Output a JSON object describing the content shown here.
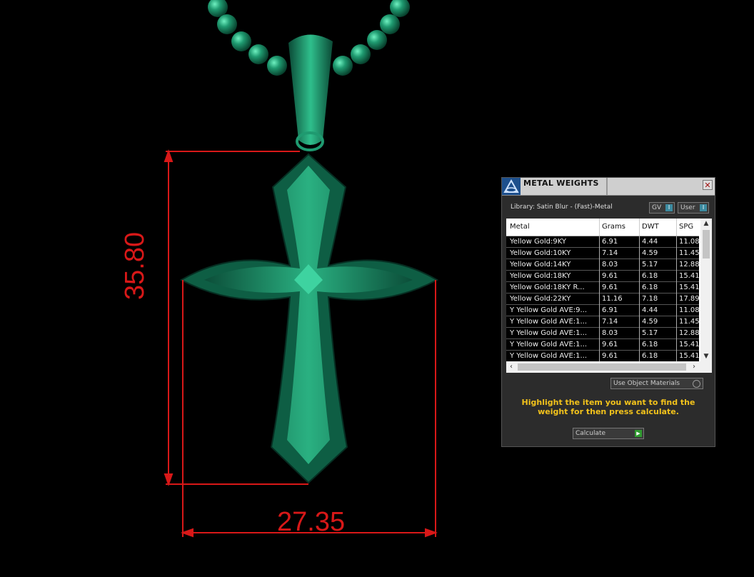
{
  "scene": {
    "height_dimension": "35.80",
    "width_dimension": "27.35",
    "dimension_color": "#d81818",
    "model_color": "#1f8f6a"
  },
  "panel": {
    "title": "METAL WEIGHTS",
    "close_icon": "close-icon",
    "library_label": "Library: Satin Blur - (Fast)-Metal",
    "gv_label": "GV",
    "user_label": "User",
    "columns": [
      "Metal",
      "Grams",
      "DWT",
      "SPG"
    ],
    "rows": [
      [
        "Yellow Gold:9KY",
        "6.91",
        "4.44",
        "11.08"
      ],
      [
        "Yellow Gold:10KY",
        "7.14",
        "4.59",
        "11.45"
      ],
      [
        "Yellow Gold:14KY",
        "8.03",
        "5.17",
        "12.88"
      ],
      [
        "Yellow Gold:18KY",
        "9.61",
        "6.18",
        "15.41"
      ],
      [
        "Yellow Gold:18KY R...",
        "9.61",
        "6.18",
        "15.41"
      ],
      [
        "Yellow Gold:22KY",
        "11.16",
        "7.18",
        "17.89"
      ],
      [
        "Y Yellow Gold AVE:9...",
        "6.91",
        "4.44",
        "11.08"
      ],
      [
        "Y Yellow Gold AVE:1...",
        "7.14",
        "4.59",
        "11.45"
      ],
      [
        "Y Yellow Gold AVE:1...",
        "8.03",
        "5.17",
        "12.88"
      ],
      [
        "Y Yellow Gold AVE:1...",
        "9.61",
        "6.18",
        "15.41"
      ],
      [
        "Y Yellow Gold AVE:1...",
        "9.61",
        "6.18",
        "15.41"
      ]
    ],
    "use_object_materials": "Use Object Materials",
    "hint": "Highlight the item you want to find the weight for then press calculate.",
    "calculate_label": "Calculate",
    "hint_color": "#f2c21b"
  }
}
